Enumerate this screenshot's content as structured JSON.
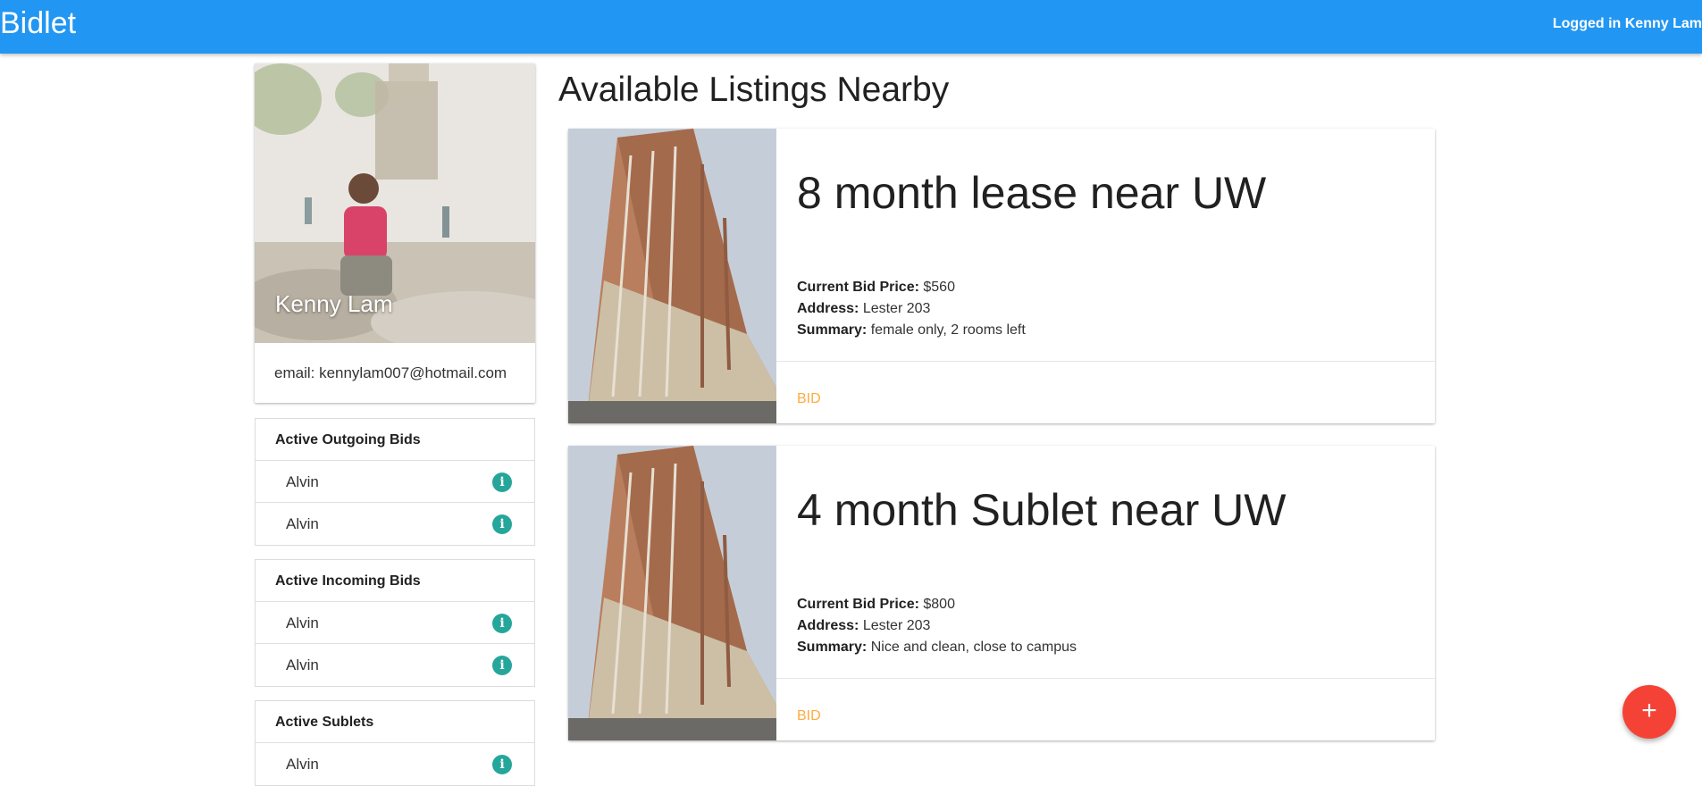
{
  "navbar": {
    "brand": "Bidlet",
    "logged_in": "Logged in Kenny Lam"
  },
  "profile": {
    "name": "Kenny Lam",
    "email": "email: kennylam007@hotmail.com"
  },
  "outgoing": {
    "title": "Active Outgoing Bids",
    "items": [
      "Alvin",
      "Alvin"
    ]
  },
  "incoming": {
    "title": "Active Incoming Bids",
    "items": [
      "Alvin",
      "Alvin"
    ]
  },
  "sublets": {
    "title": "Active Sublets",
    "items": [
      "Alvin"
    ]
  },
  "main": {
    "title": "Available Listings Nearby"
  },
  "labels": {
    "price": "Current Bid Price:",
    "address": "Address:",
    "summary": "Summary:"
  },
  "listings": [
    {
      "title": "8 month lease near UW",
      "price": "$560",
      "address": "Lester 203",
      "summary": "female only, 2 rooms left",
      "action": "BID"
    },
    {
      "title": "4 month Sublet near UW",
      "price": "$800",
      "address": "Lester 203",
      "summary": "Nice and clean, close to campus",
      "action": "BID"
    }
  ],
  "fab": {
    "icon": "plus-icon",
    "label": "+"
  },
  "colors": {
    "navbar": "#2196f3",
    "info": "#26a69a",
    "bid": "#ffab40",
    "fab": "#f44336"
  }
}
